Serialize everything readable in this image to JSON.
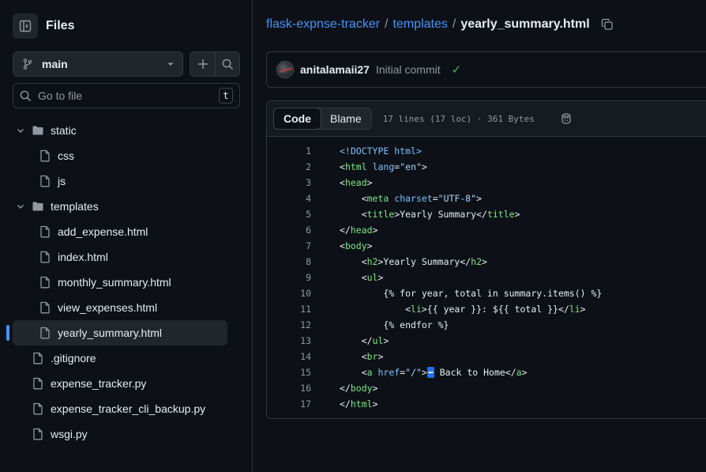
{
  "sidebar": {
    "title": "Files",
    "branch": "main",
    "search_placeholder": "Go to file",
    "search_shortcut": "t",
    "tree": [
      {
        "label": "static",
        "type": "folder",
        "depth": 0,
        "expanded": true
      },
      {
        "label": "css",
        "type": "file",
        "depth": 1
      },
      {
        "label": "js",
        "type": "file",
        "depth": 1
      },
      {
        "label": "templates",
        "type": "folder",
        "depth": 0,
        "expanded": true
      },
      {
        "label": "add_expense.html",
        "type": "file",
        "depth": 1
      },
      {
        "label": "index.html",
        "type": "file",
        "depth": 1
      },
      {
        "label": "monthly_summary.html",
        "type": "file",
        "depth": 1
      },
      {
        "label": "view_expenses.html",
        "type": "file",
        "depth": 1
      },
      {
        "label": "yearly_summary.html",
        "type": "file",
        "depth": 1,
        "active": true
      },
      {
        "label": ".gitignore",
        "type": "file",
        "depth": 0
      },
      {
        "label": "expense_tracker.py",
        "type": "file",
        "depth": 0
      },
      {
        "label": "expense_tracker_cli_backup.py",
        "type": "file",
        "depth": 0
      },
      {
        "label": "wsgi.py",
        "type": "file",
        "depth": 0
      }
    ]
  },
  "breadcrumb": {
    "repo": "flask-expnse-tracker",
    "folder": "templates",
    "file": "yearly_summary.html",
    "sep": "/"
  },
  "commit": {
    "user": "anitalamaii27",
    "message": "Initial commit"
  },
  "file_view": {
    "tab_code": "Code",
    "tab_blame": "Blame",
    "meta": "17 lines (17 loc) · 361 Bytes"
  },
  "code_lines": [
    "<!DOCTYPE html>",
    "<html lang=\"en\">",
    "<head>",
    "    <meta charset=\"UTF-8\">",
    "    <title>Yearly Summary</title>",
    "</head>",
    "<body>",
    "    <h2>Yearly Summary</h2>",
    "    <ul>",
    "        {% for year, total in summary.items() %}",
    "            <li>{{ year }}: ${{ total }}</li>",
    "        {% endfor %}",
    "    </ul>",
    "    <br>",
    "    <a href=\"/\">⬅ Back to Home</a>",
    "</body>",
    "</html>"
  ],
  "colors": {
    "link": "#4493f8",
    "tag": "#7ee787",
    "attr": "#79c0ff",
    "string": "#a5d6ff",
    "success": "#3fb950"
  }
}
